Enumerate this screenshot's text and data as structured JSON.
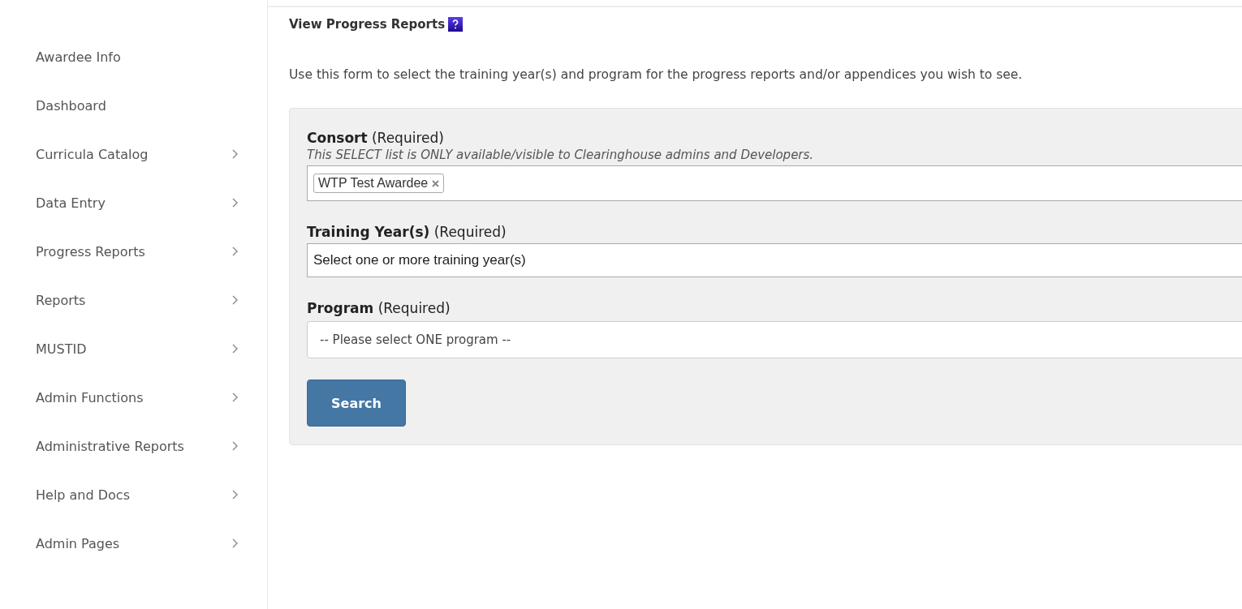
{
  "sidebar": {
    "items": [
      {
        "label": "Awardee Info",
        "expandable": false
      },
      {
        "label": "Dashboard",
        "expandable": false
      },
      {
        "label": "Curricula Catalog",
        "expandable": true
      },
      {
        "label": "Data Entry",
        "expandable": true
      },
      {
        "label": "Progress Reports",
        "expandable": true
      },
      {
        "label": "Reports",
        "expandable": true
      },
      {
        "label": "MUSTID",
        "expandable": true
      },
      {
        "label": "Admin Functions",
        "expandable": true
      },
      {
        "label": "Administrative Reports",
        "expandable": true
      },
      {
        "label": "Help and Docs",
        "expandable": true
      },
      {
        "label": "Admin Pages",
        "expandable": true
      }
    ]
  },
  "page": {
    "title": "View Progress Reports",
    "intro": "Use this form to select the training year(s) and program for the progress reports and/or appendices you wish to see."
  },
  "form": {
    "fields": [
      {
        "kind": "tags",
        "label": "Consort",
        "required_note": "(Required)",
        "note": "This SELECT list is ONLY available/visible to Clearinghouse admins and Developers.",
        "tags": [
          "WTP Test Awardee"
        ]
      },
      {
        "kind": "multiselect",
        "label": "Training Year(s)",
        "required_note": "(Required)",
        "placeholder": "Select one or more training year(s)"
      },
      {
        "kind": "select",
        "label": "Program",
        "required_note": "(Required)",
        "value": "-- Please select ONE program --"
      }
    ],
    "submit": "Search"
  }
}
